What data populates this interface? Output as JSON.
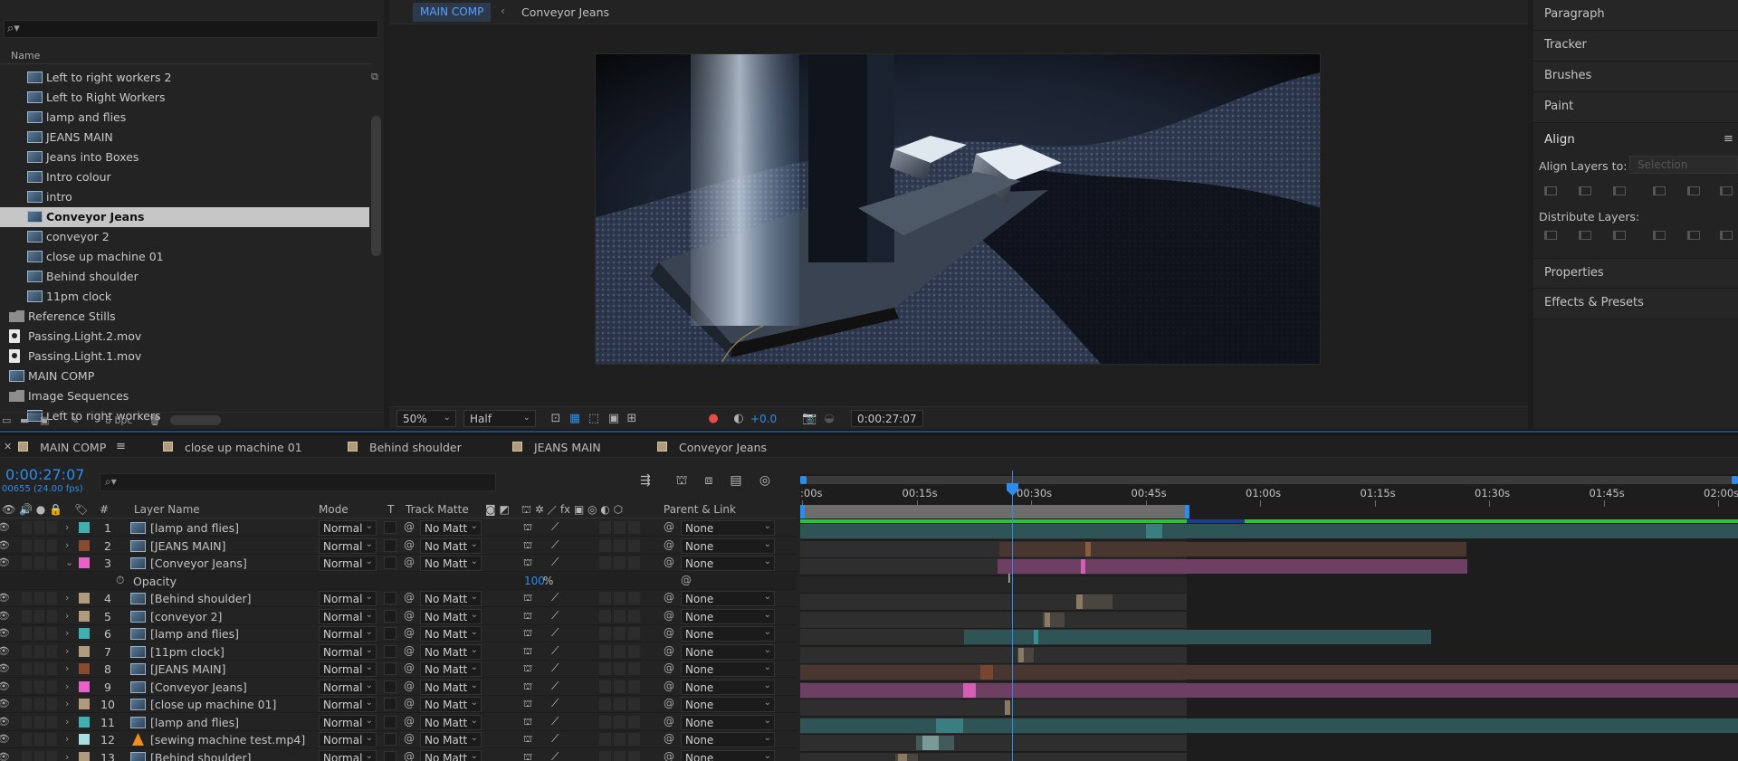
{
  "project": {
    "search_icon": "search-icon",
    "column_name": "Name",
    "bpc": "8 bpc",
    "items": [
      {
        "label": "Left to right workers 2",
        "type": "comp",
        "indent": 2,
        "selected": false
      },
      {
        "label": "Left to Right Workers",
        "type": "comp",
        "indent": 2,
        "selected": false
      },
      {
        "label": "lamp and flies",
        "type": "comp",
        "indent": 2,
        "selected": false
      },
      {
        "label": "JEANS MAIN",
        "type": "comp",
        "indent": 2,
        "selected": false
      },
      {
        "label": "Jeans into Boxes",
        "type": "comp",
        "indent": 2,
        "selected": false
      },
      {
        "label": "Intro colour",
        "type": "comp",
        "indent": 2,
        "selected": false
      },
      {
        "label": "intro",
        "type": "comp",
        "indent": 2,
        "selected": false
      },
      {
        "label": "Conveyor Jeans",
        "type": "comp",
        "indent": 2,
        "selected": true
      },
      {
        "label": "conveyor 2",
        "type": "comp",
        "indent": 2,
        "selected": false
      },
      {
        "label": "close up machine 01",
        "type": "comp",
        "indent": 2,
        "selected": false
      },
      {
        "label": "Behind shoulder",
        "type": "comp",
        "indent": 2,
        "selected": false
      },
      {
        "label": "11pm clock",
        "type": "comp",
        "indent": 2,
        "selected": false
      },
      {
        "label": "Reference Stills",
        "type": "folder",
        "indent": 1,
        "selected": false
      },
      {
        "label": "Passing.Light.2.mov",
        "type": "movie",
        "indent": 1,
        "selected": false
      },
      {
        "label": "Passing.Light.1.mov",
        "type": "movie",
        "indent": 1,
        "selected": false
      },
      {
        "label": "MAIN COMP",
        "type": "comp",
        "indent": 1,
        "selected": false
      },
      {
        "label": "Image Sequences",
        "type": "folder",
        "indent": 1,
        "selected": false
      },
      {
        "label": "Left to right workers",
        "type": "comp",
        "indent": 2,
        "selected": false
      }
    ]
  },
  "viewer": {
    "tab_main": "MAIN COMP",
    "tab_arrow": "‹",
    "tab_current": "Conveyor Jeans",
    "zoom": "50%",
    "resolution": "Half",
    "exposure": "+0.0",
    "timecode": "0:00:27:07"
  },
  "right_panel": {
    "items": [
      "Paragraph",
      "Tracker",
      "Brushes",
      "Paint"
    ],
    "align_title": "Align",
    "align_layers_to": "Align Layers to:",
    "align_selection": "Selection",
    "distribute_layers": "Distribute Layers:",
    "bottom_items": [
      "Properties",
      "Effects & Presets"
    ]
  },
  "timeline": {
    "tabs": [
      {
        "label": "MAIN COMP"
      },
      {
        "label": "close up machine 01"
      },
      {
        "label": "Behind shoulder"
      },
      {
        "label": "JEANS MAIN"
      },
      {
        "label": "Conveyor Jeans"
      }
    ],
    "current_time": "0:00:27:07",
    "fps": "00655 (24.00 fps)",
    "columns": {
      "num": "#",
      "layer_name": "Layer Name",
      "mode": "Mode",
      "t": "T",
      "track_matte": "Track Matte",
      "parent": "Parent & Link"
    },
    "ruler": [
      ":00s",
      "00:15s",
      "00:30s",
      "00:45s",
      "01:00s",
      "01:15s",
      "01:30s",
      "01:45s",
      "02:00s"
    ],
    "layers": [
      {
        "num": "1",
        "name": "[lamp and flies]",
        "color": "#3fb0b0",
        "icon": "comp",
        "mode": "Normal",
        "matte": "No Matt",
        "parent": "None",
        "bar_color": "#2f5456",
        "bar_start": 0,
        "bar_end": 1036,
        "hi_at": 382,
        "hi_w": 18,
        "hi_color": "#3b7e80"
      },
      {
        "num": "2",
        "name": "[JEANS MAIN]",
        "color": "#8a4a2e",
        "icon": "comp",
        "mode": "Normal",
        "matte": "No Matt",
        "parent": "None",
        "bar_color": "#4a3631",
        "bar_start": 220,
        "bar_end": 736,
        "hi_at": 315,
        "hi_w": 6,
        "hi_color": "#8b5b40"
      },
      {
        "num": "3",
        "name": "[Conveyor Jeans]",
        "color": "#e860c8",
        "icon": "comp",
        "mode": "Normal",
        "matte": "No Matt",
        "parent": "None",
        "expanded": true,
        "bar_color": "#6d3f63",
        "bar_start": 218,
        "bar_end": 737,
        "hi_at": 310,
        "hi_w": 5,
        "hi_color": "#d25fb3"
      },
      {
        "num": "4",
        "name": "[Behind shoulder]",
        "color": "#b09c7c",
        "icon": "comp",
        "mode": "Normal",
        "matte": "No Matt",
        "parent": "None",
        "bar_color": "#4a4540",
        "bar_start": 305,
        "bar_end": 345,
        "hi_at": 305,
        "hi_w": 7,
        "hi_color": "#8a7a63"
      },
      {
        "num": "5",
        "name": "[conveyor 2]",
        "color": "#b09c7c",
        "icon": "comp",
        "mode": "Normal",
        "matte": "No Matt",
        "parent": "None",
        "bar_color": "#4a4540",
        "bar_start": 268,
        "bar_end": 292,
        "hi_at": 270,
        "hi_w": 6,
        "hi_color": "#8a7a63"
      },
      {
        "num": "6",
        "name": "[lamp and flies]",
        "color": "#3fb0b0",
        "icon": "comp",
        "mode": "Normal",
        "matte": "No Matt",
        "parent": "None",
        "bar_color": "#2f5456",
        "bar_start": 181,
        "bar_end": 697,
        "hi_at": 258,
        "hi_w": 5,
        "hi_color": "#3b8e90"
      },
      {
        "num": "7",
        "name": "[11pm clock]",
        "color": "#b09c7c",
        "icon": "comp",
        "mode": "Normal",
        "matte": "No Matt",
        "parent": "None",
        "bar_color": "#4a4540",
        "bar_start": 240,
        "bar_end": 258,
        "hi_at": 241,
        "hi_w": 6,
        "hi_color": "#8a7a63"
      },
      {
        "num": "8",
        "name": "[JEANS MAIN]",
        "color": "#8a4a2e",
        "icon": "comp",
        "mode": "Normal",
        "matte": "No Matt",
        "parent": "None",
        "bar_color": "#4a3631",
        "bar_start": 0,
        "bar_end": 1036,
        "hi_at": 199,
        "hi_w": 14,
        "hi_color": "#7a4530"
      },
      {
        "num": "9",
        "name": "[Conveyor Jeans]",
        "color": "#e860c8",
        "icon": "comp",
        "mode": "Normal",
        "matte": "No Matt",
        "parent": "None",
        "bar_color": "#6d3f63",
        "bar_start": 0,
        "bar_end": 1036,
        "hi_at": 180,
        "hi_w": 14,
        "hi_color": "#d25fb3"
      },
      {
        "num": "10",
        "name": "[close up machine 01]",
        "color": "#b09c7c",
        "icon": "comp",
        "mode": "Normal",
        "matte": "No Matt",
        "parent": "None",
        "bar_color": "#4a4540",
        "bar_start": 226,
        "bar_end": 232,
        "hi_at": 226,
        "hi_w": 6,
        "hi_color": "#8a7a63"
      },
      {
        "num": "11",
        "name": "[lamp and flies]",
        "color": "#3fb0b0",
        "icon": "comp",
        "mode": "Normal",
        "matte": "No Matt",
        "parent": "None",
        "bar_color": "#2f5456",
        "bar_start": 0,
        "bar_end": 1036,
        "hi_at": 150,
        "hi_w": 30,
        "hi_color": "#3b7e80"
      },
      {
        "num": "12",
        "name": "[sewing machine test.mp4]",
        "color": "#a8e0e0",
        "icon": "vlc",
        "mode": "Normal",
        "matte": "No Matt",
        "parent": "None",
        "bar_color": "#435a5a",
        "bar_start": 128,
        "bar_end": 170,
        "hi_at": 135,
        "hi_w": 18,
        "hi_color": "#7a9a9a"
      },
      {
        "num": "13",
        "name": "[Behind shoulder]",
        "color": "#b09c7c",
        "icon": "comp",
        "mode": "Normal",
        "matte": "No Matt",
        "parent": "None",
        "bar_color": "#4a4540",
        "bar_start": 105,
        "bar_end": 130,
        "hi_at": 108,
        "hi_w": 10,
        "hi_color": "#8a7a63"
      }
    ],
    "opacity": {
      "name": "Opacity",
      "value": "100",
      "unit": "%"
    }
  }
}
